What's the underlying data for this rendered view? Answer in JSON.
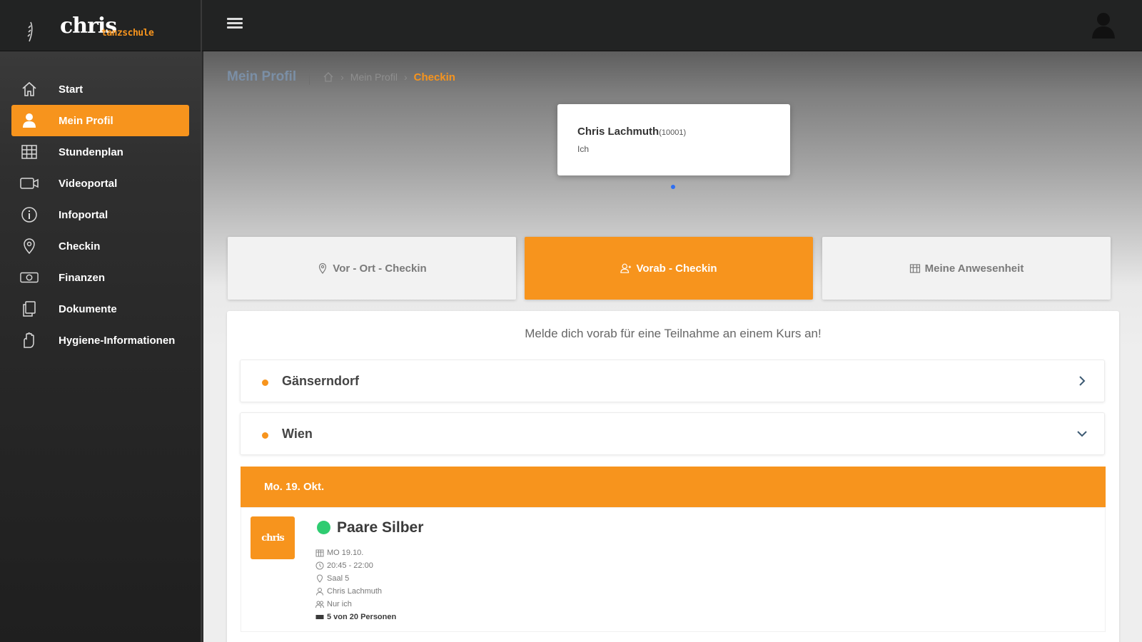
{
  "app": {
    "logo_text": "chris",
    "logo_sub": "tanzschule"
  },
  "colors": {
    "accent": "#f7941d",
    "sidebar_bg": "#262626",
    "topbar_bg": "#222323",
    "status_green": "#2ecc71",
    "breadcrumb_title": "#7b8fa6",
    "carousel_dot": "#2e6ff2"
  },
  "sidebar": {
    "items": [
      {
        "label": "Start",
        "icon": "home-icon"
      },
      {
        "label": "Mein Profil",
        "icon": "user-icon",
        "active": true
      },
      {
        "label": "Stundenplan",
        "icon": "grid-icon"
      },
      {
        "label": "Videoportal",
        "icon": "video-icon"
      },
      {
        "label": "Infoportal",
        "icon": "info-icon"
      },
      {
        "label": "Checkin",
        "icon": "location-pin-icon"
      },
      {
        "label": "Finanzen",
        "icon": "money-icon"
      },
      {
        "label": "Dokumente",
        "icon": "documents-icon"
      },
      {
        "label": "Hygiene-Informationen",
        "icon": "hygiene-icon"
      }
    ]
  },
  "breadcrumb": {
    "title": "Mein Profil",
    "path": [
      "Mein Profil"
    ],
    "current": "Checkin"
  },
  "profile_card": {
    "name": "Chris Lachmuth",
    "id": "(10001)",
    "role": "Ich"
  },
  "tabs": [
    {
      "label": "Vor - Ort - Checkin",
      "icon": "location-pin-icon"
    },
    {
      "label": "Vorab - Checkin",
      "icon": "person-icon",
      "active": true
    },
    {
      "label": "Meine Anwesenheit",
      "icon": "calendar-icon"
    }
  ],
  "panel": {
    "intro": "Melde dich vorab für eine Teilnahme an einem Kurs an!",
    "locations": [
      {
        "label": "Gänserndorf",
        "state": "collapsed"
      },
      {
        "label": "Wien",
        "state": "expanded"
      }
    ],
    "date_header": "Mo. 19. Okt.",
    "course": {
      "logo_text": "chris",
      "title": "Paare Silber",
      "meta": [
        {
          "icon": "calendar-icon",
          "text": "MO 19.10."
        },
        {
          "icon": "clock-icon",
          "text": "20:45 - 22:00"
        },
        {
          "icon": "location-pin-icon",
          "text": "Saal 5"
        },
        {
          "icon": "person-icon",
          "text": "Chris Lachmuth"
        },
        {
          "icon": "people-icon",
          "text": "Nur ich"
        },
        {
          "icon": "capacity-icon",
          "text": "5 von 20 Personen"
        }
      ]
    }
  }
}
